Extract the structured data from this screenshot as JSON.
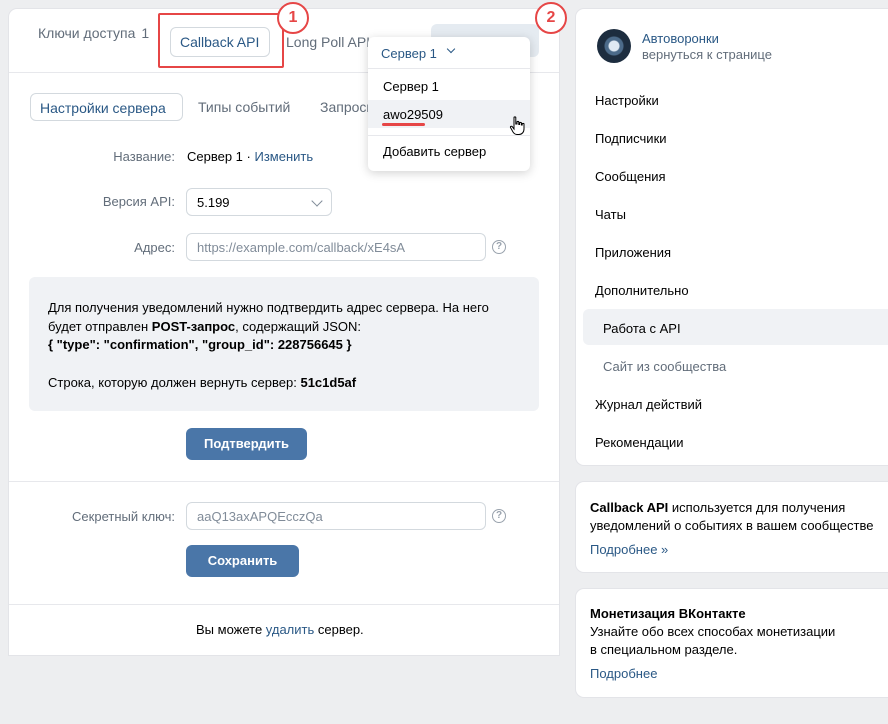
{
  "top_tabs": {
    "access_keys": "Ключи доступа",
    "access_keys_count": "1",
    "callback_api": "Callback API",
    "long_poll_api": "Long Poll API"
  },
  "annotations": {
    "badge_1": "1",
    "badge_2": "2"
  },
  "server_dropdown": {
    "selected": "Сервер 1",
    "items": [
      "Сервер 1",
      "awo29509"
    ],
    "add_server": "Добавить сервер"
  },
  "sub_tabs": {
    "server_settings": "Настройки сервера",
    "event_types": "Типы событий",
    "requests": "Запросы"
  },
  "form": {
    "name_label": "Название:",
    "name_value": "Сервер 1 ·",
    "name_edit": "Изменить",
    "api_version_label": "Версия API:",
    "api_version_value": "5.199",
    "address_label": "Адрес:",
    "address_placeholder": "https://example.com/callback/xE4sA",
    "help_glyph": "?"
  },
  "info": {
    "line1": "Для получения уведомлений нужно подтвердить адрес сервера. На него",
    "line2_prefix": "будет отправлен ",
    "line2_bold": "POST-запрос",
    "line2_suffix": ", содержащий JSON:",
    "line3": "{ \"type\": \"confirmation\", \"group_id\": 228756645 }",
    "line4_prefix": "Строка, которую должен вернуть сервер: ",
    "line4_bold": "51c1d5af"
  },
  "buttons": {
    "confirm": "Подтвердить",
    "save": "Сохранить"
  },
  "secret": {
    "label": "Секретный ключ:",
    "value": "aaQ13axAPQEcczQa"
  },
  "footer": {
    "prefix": "Вы можете ",
    "link": "удалить",
    "suffix": " сервер."
  },
  "community": {
    "name": "Автоворонки",
    "back": "вернуться к странице"
  },
  "menu": {
    "items": [
      "Настройки",
      "Подписчики",
      "Сообщения",
      "Чаты",
      "Приложения",
      "Дополнительно"
    ],
    "active": "Работа с API",
    "sub": "Сайт из сообщества",
    "items2": [
      "Журнал действий",
      "Рекомендации"
    ]
  },
  "callback_card": {
    "bold": "Callback API",
    "text1": " используется для получения",
    "text2": "уведомлений о событиях в вашем сообществе",
    "more": "Подробнее »"
  },
  "monetization_card": {
    "title": "Монетизация ВКонтакте",
    "line1": "Узнайте обо всех способах монетизации",
    "line2": "в специальном разделе.",
    "more": "Подробнее"
  },
  "colors": {
    "accent": "#2a5885",
    "button": "#4a76a8",
    "annotation": "#e64646",
    "background": "#edeef0"
  }
}
